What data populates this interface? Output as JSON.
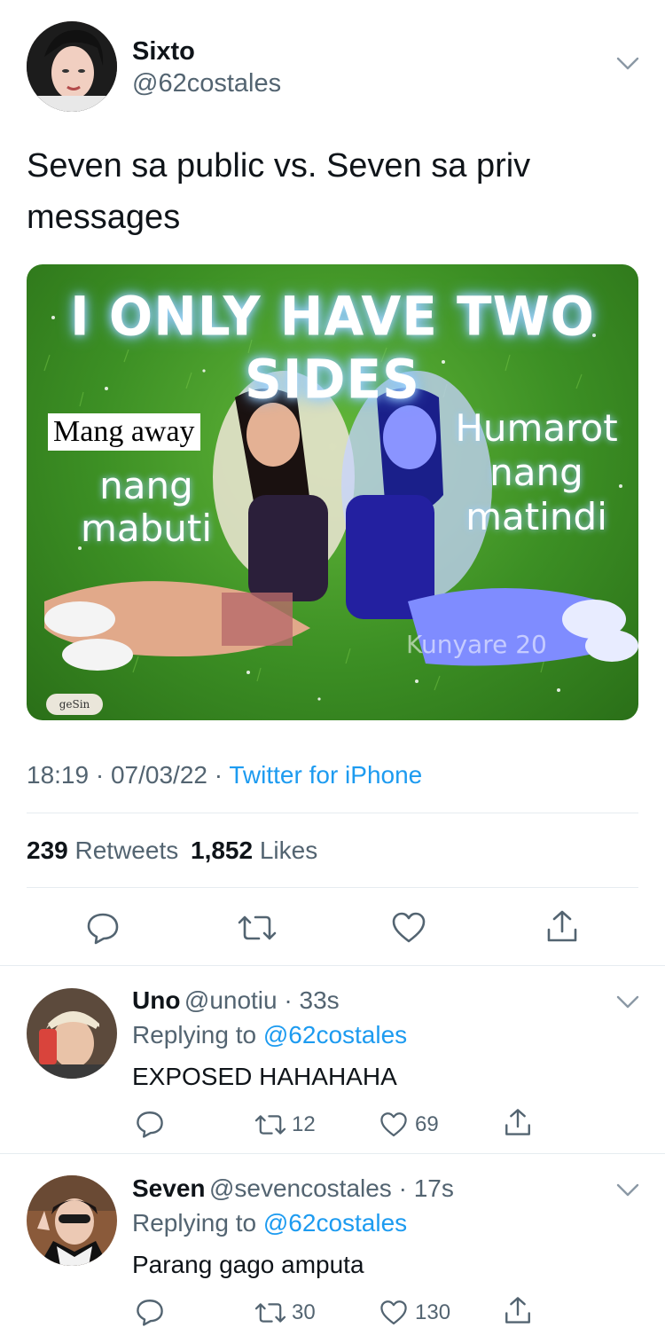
{
  "tweet": {
    "author_name": "Sixto",
    "author_handle": "@62costales",
    "text": "Seven sa public vs. Seven sa priv messages",
    "media": {
      "title": "I ONLY HAVE TWO SIDES",
      "left_box": "Mang away",
      "left_caption": "nang mabuti",
      "right_caption": "Humarot nang matindi",
      "watermark": "Kunyare 20",
      "logo": "geSin"
    },
    "time": "18:19",
    "date": "07/03/22",
    "source": "Twitter for iPhone",
    "retweets": "239",
    "retweets_label": "Retweets",
    "likes": "1,852",
    "likes_label": "Likes"
  },
  "replies": [
    {
      "name": "Uno",
      "handle": "@unotiu",
      "time": "33s",
      "replying_label": "Replying to",
      "replying_to": "@62costales",
      "text": "EXPOSED HAHAHAHA",
      "retweets": "12",
      "likes": "69"
    },
    {
      "name": "Seven",
      "handle": "@sevencostales",
      "time": "17s",
      "replying_label": "Replying to",
      "replying_to": "@62costales",
      "text": "Parang gago amputa",
      "retweets": "30",
      "likes": "130"
    }
  ],
  "icons": {
    "reply": "reply-icon",
    "retweet": "retweet-icon",
    "like": "heart-icon",
    "share": "share-icon",
    "more": "chevron-down-icon"
  },
  "colors": {
    "accent": "#1d9bf0",
    "secondary_text": "#536471",
    "divider": "#e6ecf0"
  }
}
